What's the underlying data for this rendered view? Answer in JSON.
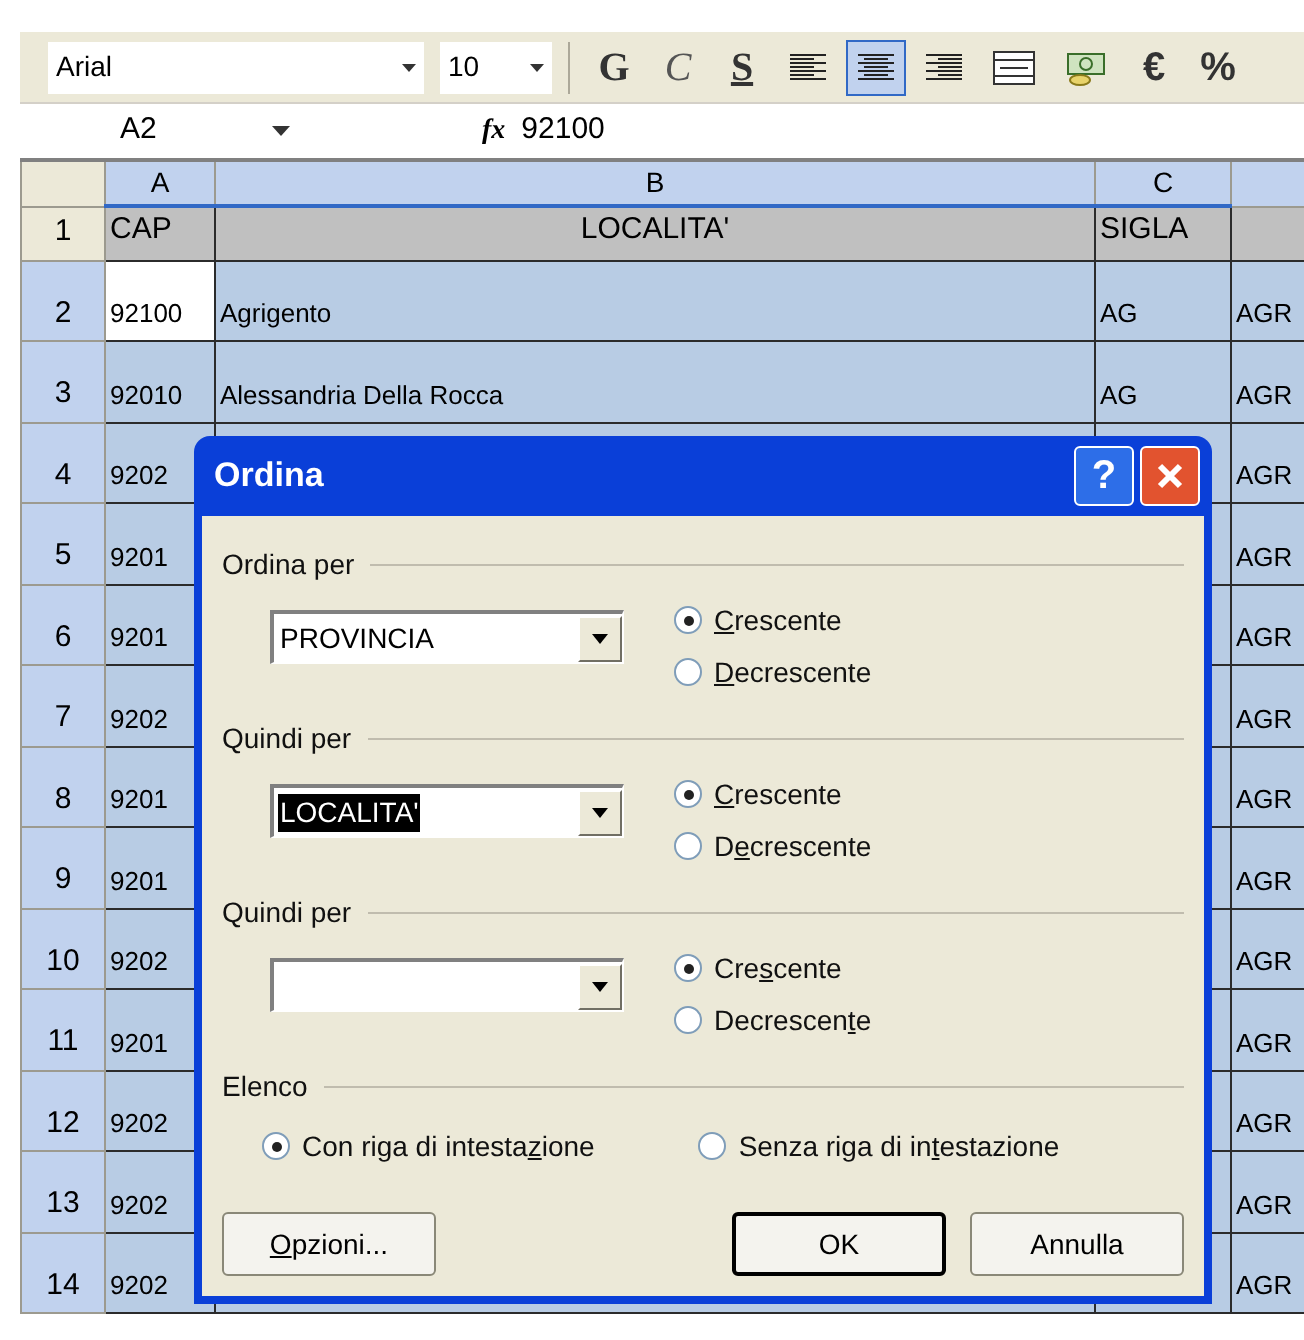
{
  "toolbar": {
    "font": "Arial",
    "size": "10",
    "buttons": [
      {
        "kind": "bold",
        "label": "G",
        "selected": false
      },
      {
        "kind": "italic",
        "label": "C",
        "selected": false
      },
      {
        "kind": "underline",
        "label": "S",
        "selected": false
      },
      {
        "kind": "align-left",
        "selected": false
      },
      {
        "kind": "align-center",
        "selected": true
      },
      {
        "kind": "align-right",
        "selected": false
      },
      {
        "kind": "merge",
        "selected": false
      },
      {
        "kind": "currency",
        "selected": false
      },
      {
        "kind": "text",
        "label": "€",
        "selected": false
      },
      {
        "kind": "text",
        "label": "%",
        "selected": false
      }
    ]
  },
  "formula_bar": {
    "name_box": "A2",
    "fx": "fx",
    "value": "92100"
  },
  "columns": [
    "A",
    "B",
    "C"
  ],
  "rows": [
    {
      "header": "1",
      "selected": false,
      "cells": [
        {
          "text": "CAP",
          "active": false
        },
        {
          "text": "LOCALITA'",
          "active": false
        },
        {
          "text": "SIGLA",
          "active": false
        },
        {
          "active": false
        }
      ]
    },
    {
      "header": "2",
      "selected": true,
      "cells": [
        {
          "text": "92100",
          "active": true
        },
        {
          "text": "Agrigento",
          "active": false
        },
        {
          "text": "AG",
          "active": false
        },
        {
          "text": "AGR",
          "active": false
        }
      ]
    },
    {
      "header": "3",
      "selected": true,
      "cells": [
        {
          "text": "92010",
          "active": false
        },
        {
          "text": "Alessandria Della Rocca",
          "active": false
        },
        {
          "text": "AG",
          "active": false
        },
        {
          "text": "AGR",
          "active": false
        }
      ]
    },
    {
      "header": "4",
      "selected": true,
      "cells": [
        {
          "text": "9202",
          "active": false
        },
        {},
        {},
        {
          "text": "AGR",
          "active": false
        }
      ]
    },
    {
      "header": "5",
      "selected": true,
      "cells": [
        {
          "text": "9201",
          "active": false
        },
        {},
        {},
        {
          "text": "AGR",
          "active": false
        }
      ]
    },
    {
      "header": "6",
      "selected": true,
      "cells": [
        {
          "text": "9201",
          "active": false
        },
        {},
        {},
        {
          "text": "AGR",
          "active": false
        }
      ]
    },
    {
      "header": "7",
      "selected": true,
      "cells": [
        {
          "text": "9202",
          "active": false
        },
        {},
        {},
        {
          "text": "AGR",
          "active": false
        }
      ]
    },
    {
      "header": "8",
      "selected": true,
      "cells": [
        {
          "text": "9201",
          "active": false
        },
        {},
        {},
        {
          "text": "AGR",
          "active": false
        }
      ]
    },
    {
      "header": "9",
      "selected": true,
      "cells": [
        {
          "text": "9201",
          "active": false
        },
        {},
        {},
        {
          "text": "AGR",
          "active": false
        }
      ]
    },
    {
      "header": "10",
      "selected": true,
      "cells": [
        {
          "text": "9202",
          "active": false
        },
        {},
        {},
        {
          "text": "AGR",
          "active": false
        }
      ]
    },
    {
      "header": "11",
      "selected": true,
      "cells": [
        {
          "text": "9201",
          "active": false
        },
        {},
        {},
        {
          "text": "AGR",
          "active": false
        }
      ]
    },
    {
      "header": "12",
      "selected": true,
      "cells": [
        {
          "text": "9202",
          "active": false
        },
        {},
        {},
        {
          "text": "AGR",
          "active": false
        }
      ]
    },
    {
      "header": "13",
      "selected": true,
      "cells": [
        {
          "text": "9202",
          "active": false
        },
        {},
        {},
        {
          "text": "AGR",
          "active": false
        }
      ]
    },
    {
      "header": "14",
      "selected": true,
      "cells": [
        {
          "text": "9202",
          "active": false
        },
        {},
        {},
        {
          "text": "AGR",
          "active": false
        }
      ]
    }
  ],
  "dialog": {
    "title": "Ordina",
    "help": "?",
    "sort_keys": [
      {
        "label": "Ordina per",
        "select": {
          "value": "PROVINCIA",
          "focused": false
        },
        "options": [
          {
            "key": "C",
            "post": "rescente",
            "selected": true
          },
          {
            "key": "D",
            "post": "ecrescente",
            "selected": false
          }
        ]
      },
      {
        "label": "Quindi per",
        "select": {
          "value": "LOCALITA'",
          "focused": true
        },
        "options": [
          {
            "key": "C",
            "post": "rescente",
            "selected": true
          },
          {
            "pre": "D",
            "key": "e",
            "post": "crescente",
            "selected": false
          }
        ]
      },
      {
        "label": "Quindi per",
        "select": {
          "focused": false
        },
        "options": [
          {
            "pre": "Cre",
            "key": "s",
            "post": "cente",
            "selected": true
          },
          {
            "pre": "Decrescen",
            "key": "t",
            "post": "e",
            "selected": false
          }
        ]
      }
    ],
    "list": {
      "label": "Elenco",
      "options": [
        {
          "pre": "Con riga di intesta",
          "key": "z",
          "post": "ione",
          "selected": true
        },
        {
          "pre": "Senza riga di in",
          "key": "t",
          "post": "estazione",
          "selected": false
        }
      ]
    },
    "buttons": [
      {
        "key": "O",
        "post": "pzioni...",
        "default": false
      },
      {
        "label": "OK",
        "default": true
      },
      {
        "label": "Annulla",
        "default": false
      }
    ]
  }
}
